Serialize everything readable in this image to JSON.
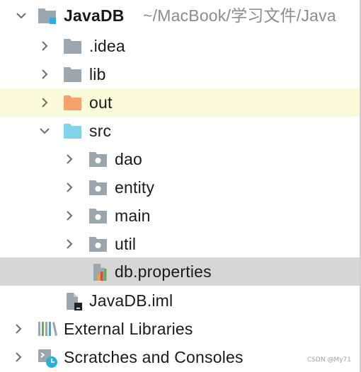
{
  "tree": {
    "root": {
      "name": "JavaDB",
      "path": "~/MacBook/学习文件/Java"
    },
    "items": [
      {
        "label": ".idea",
        "icon": "folder-icon"
      },
      {
        "label": "lib",
        "icon": "folder-icon"
      },
      {
        "label": "out",
        "icon": "excluded-folder-icon"
      },
      {
        "label": "src",
        "icon": "source-folder-icon"
      },
      {
        "label": "dao",
        "icon": "package-icon"
      },
      {
        "label": "entity",
        "icon": "package-icon"
      },
      {
        "label": "main",
        "icon": "package-icon"
      },
      {
        "label": "util",
        "icon": "package-icon"
      },
      {
        "label": "db.properties",
        "icon": "properties-file-icon"
      },
      {
        "label": "JavaDB.iml",
        "icon": "module-file-icon"
      },
      {
        "label": "External Libraries",
        "icon": "libraries-icon"
      },
      {
        "label": "Scratches and Consoles",
        "icon": "scratches-icon"
      }
    ]
  },
  "watermark": "CSDN @My71",
  "colors": {
    "folder": "#9aa7b0",
    "excluded_folder": "#f4a16b",
    "source_folder": "#7fd3ea",
    "row_highlight": "#fbfbdc",
    "row_selected": "#d6d6d6",
    "path_text": "#8c8c8c",
    "module_badge": "#26b0e0"
  }
}
